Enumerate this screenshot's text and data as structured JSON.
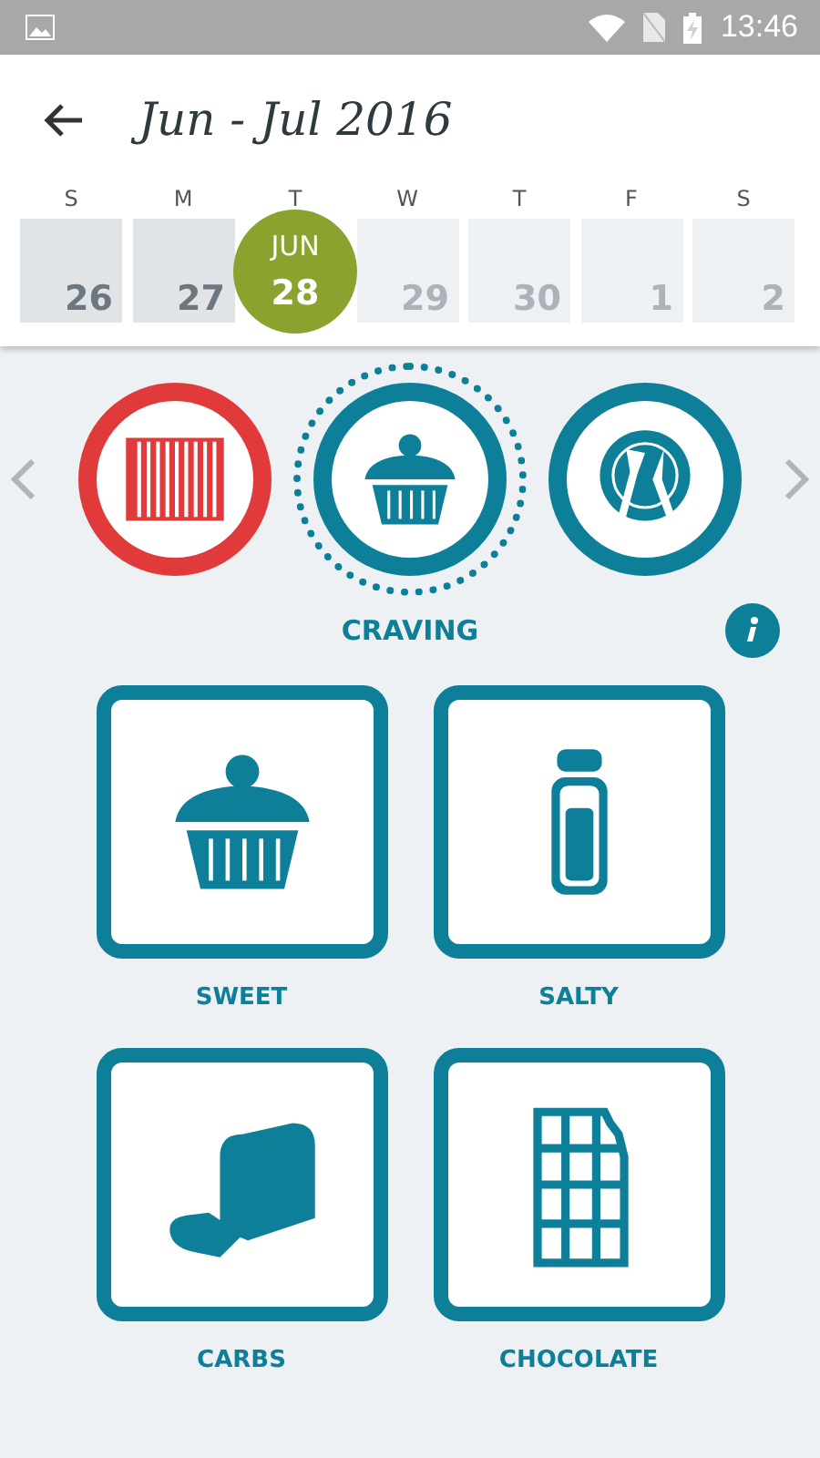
{
  "status_bar": {
    "time": "13:46"
  },
  "header": {
    "title": "Jun - Jul 2016"
  },
  "weekdays": [
    "S",
    "M",
    "T",
    "W",
    "T",
    "F",
    "S"
  ],
  "days": [
    {
      "number": "26",
      "past": true,
      "selected": false
    },
    {
      "number": "27",
      "past": true,
      "selected": false
    },
    {
      "number": "28",
      "month": "JUN",
      "past": false,
      "selected": true
    },
    {
      "number": "29",
      "past": false,
      "selected": false
    },
    {
      "number": "30",
      "past": false,
      "selected": false
    },
    {
      "number": "1",
      "past": false,
      "selected": false
    },
    {
      "number": "2",
      "past": false,
      "selected": false
    }
  ],
  "categories": [
    {
      "kind": "candy",
      "color": "#e03a3a",
      "selected": false
    },
    {
      "kind": "cupcake",
      "color": "#0e7f98",
      "selected": true
    },
    {
      "kind": "plate",
      "color": "#0e7f98",
      "selected": false
    }
  ],
  "category_label": "CRAVING",
  "options": [
    {
      "kind": "cupcake",
      "label": "SWEET"
    },
    {
      "kind": "shaker",
      "label": "SALTY"
    },
    {
      "kind": "bread",
      "label": "CARBS"
    },
    {
      "kind": "chocolate",
      "label": "CHOCOLATE"
    }
  ]
}
